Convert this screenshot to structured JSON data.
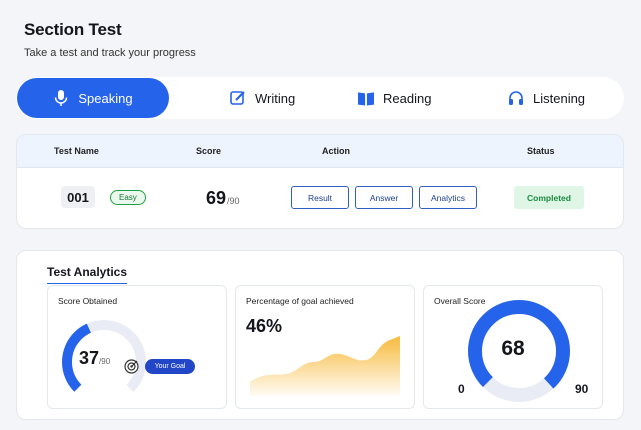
{
  "header": {
    "title": "Section Test",
    "subtitle": "Take a test and track your progress"
  },
  "tabs": [
    {
      "label": "Speaking",
      "icon": "microphone-icon",
      "active": true
    },
    {
      "label": "Writing",
      "icon": "edit-icon",
      "active": false
    },
    {
      "label": "Reading",
      "icon": "book-icon",
      "active": false
    },
    {
      "label": "Listening",
      "icon": "headphones-icon",
      "active": false
    }
  ],
  "table": {
    "columns": [
      "Test Name",
      "Score",
      "Action",
      "Status"
    ],
    "row": {
      "test_id": "001",
      "level": "Easy",
      "score": "69",
      "score_max": "/90",
      "actions": [
        "Result",
        "Answer",
        "Analytics"
      ],
      "status": "Completed"
    }
  },
  "analytics": {
    "title": "Test Analytics",
    "score_obtained": {
      "title": "Score Obtained",
      "value": "37",
      "max": "/90",
      "fraction": 0.41,
      "goal_label": "Your Goal"
    },
    "goal_achieved": {
      "title": "Percentage of goal achieved",
      "value": "46%"
    },
    "overall_score": {
      "title": "Overall Score",
      "value": "68",
      "min": "0",
      "max": "90",
      "fraction": 0.756
    }
  },
  "colors": {
    "accent": "#2563eb",
    "success": "#1a8a3f",
    "chart_fill": "#f7b733"
  }
}
